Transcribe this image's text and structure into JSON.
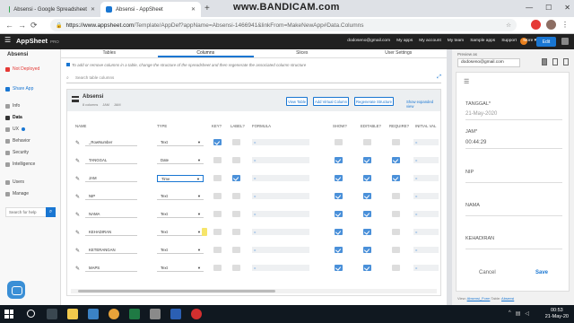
{
  "browser": {
    "tabs": [
      {
        "title": "Absensi - Google Spreadsheet",
        "color": "#34a853"
      },
      {
        "title": "Absensi - AppSheet",
        "color": "#1976d2"
      }
    ],
    "watermark": "www.BANDICAM.com",
    "url_host": "https://www.appsheet.com",
    "url_path": "/Template/AppDef?appName=Absensi-1466941&linkFrom=MakeNewApp#Data.Columns"
  },
  "header": {
    "logo": "AppSheet",
    "logo_tag": "PRO",
    "email": "dodoseno@gmail.com",
    "nav": [
      "My apps",
      "My account",
      "My team",
      "Sample apps",
      "Support"
    ],
    "more": "More",
    "edit": "Edit"
  },
  "sidebar": {
    "app_name": "Absensi",
    "items": [
      {
        "label": "Not Deployed",
        "icon": "warning-icon"
      },
      {
        "label": "Share App",
        "icon": "share-icon"
      },
      {
        "label": "Info",
        "icon": "info-icon"
      },
      {
        "label": "Data",
        "icon": "data-icon"
      },
      {
        "label": "UX",
        "icon": "ux-icon"
      },
      {
        "label": "Behavior",
        "icon": "behavior-icon"
      },
      {
        "label": "Security",
        "icon": "security-icon"
      },
      {
        "label": "Intelligence",
        "icon": "intelligence-icon"
      },
      {
        "label": "Users",
        "icon": "users-icon"
      },
      {
        "label": "Manage",
        "icon": "manage-icon"
      }
    ],
    "search_help": "Search for help"
  },
  "subtabs": [
    "Tables",
    "Columns",
    "Slices",
    "User Settings"
  ],
  "hint": "To add or remove columns in a table, change the structure of the spreadsheet and then regenerate the associated column structure",
  "table_search_placeholder": "Search table columns",
  "panel": {
    "title": "Absensi",
    "meta": [
      "8 columns",
      "JAM",
      "JAM"
    ],
    "buttons": [
      "View Table",
      "Add Virtual Column",
      "Regenerate Structure"
    ],
    "show_expanded": "Show expanded view"
  },
  "columns": [
    "NAME",
    "TYPE",
    "KEY?",
    "LABEL?",
    "FORMULA",
    "SHOW?",
    "EDITABLE?",
    "REQUIRE?",
    "INITIAL VAL"
  ],
  "rows": [
    {
      "name": "_RowNumber",
      "type": "Text",
      "key": true,
      "label": false,
      "show": false,
      "editable": false,
      "require": false
    },
    {
      "name": "TANGGAL",
      "type": "Date",
      "key": false,
      "label": false,
      "show": true,
      "editable": true,
      "require": true
    },
    {
      "name": "JAM",
      "type": "Time",
      "key": false,
      "label": true,
      "show": true,
      "editable": true,
      "require": true
    },
    {
      "name": "NIP",
      "type": "Text",
      "key": false,
      "label": false,
      "show": true,
      "editable": true,
      "require": false
    },
    {
      "name": "NAMA",
      "type": "Text",
      "key": false,
      "label": false,
      "show": true,
      "editable": true,
      "require": false
    },
    {
      "name": "KEHADIRAN",
      "type": "Text",
      "key": false,
      "label": false,
      "show": true,
      "editable": true,
      "require": false
    },
    {
      "name": "KETERANGAN",
      "type": "Text",
      "key": false,
      "label": false,
      "show": true,
      "editable": true,
      "require": false
    },
    {
      "name": "MAPS",
      "type": "Text",
      "key": false,
      "label": false,
      "show": true,
      "editable": true,
      "require": false
    }
  ],
  "formula_symbol": "=",
  "preview": {
    "label": "Preview as",
    "account": "dodoseno@gmail.com",
    "fields": [
      {
        "label": "TANGGAL",
        "value": "21-May-2020"
      },
      {
        "label": "JAM",
        "value": "00:44:29"
      },
      {
        "label": "NIP",
        "value": ""
      },
      {
        "label": "NAMA",
        "value": ""
      },
      {
        "label": "KEHADIRAN",
        "value": ""
      }
    ],
    "required_mark": "*",
    "cancel": "Cancel",
    "save": "Save",
    "footer_view_label": "View:",
    "footer_view": "Absensi_Form",
    "footer_table_label": "Table:",
    "footer_table": "Absensi"
  },
  "taskbar": {
    "time": "00:53",
    "date": "21-May-20"
  }
}
